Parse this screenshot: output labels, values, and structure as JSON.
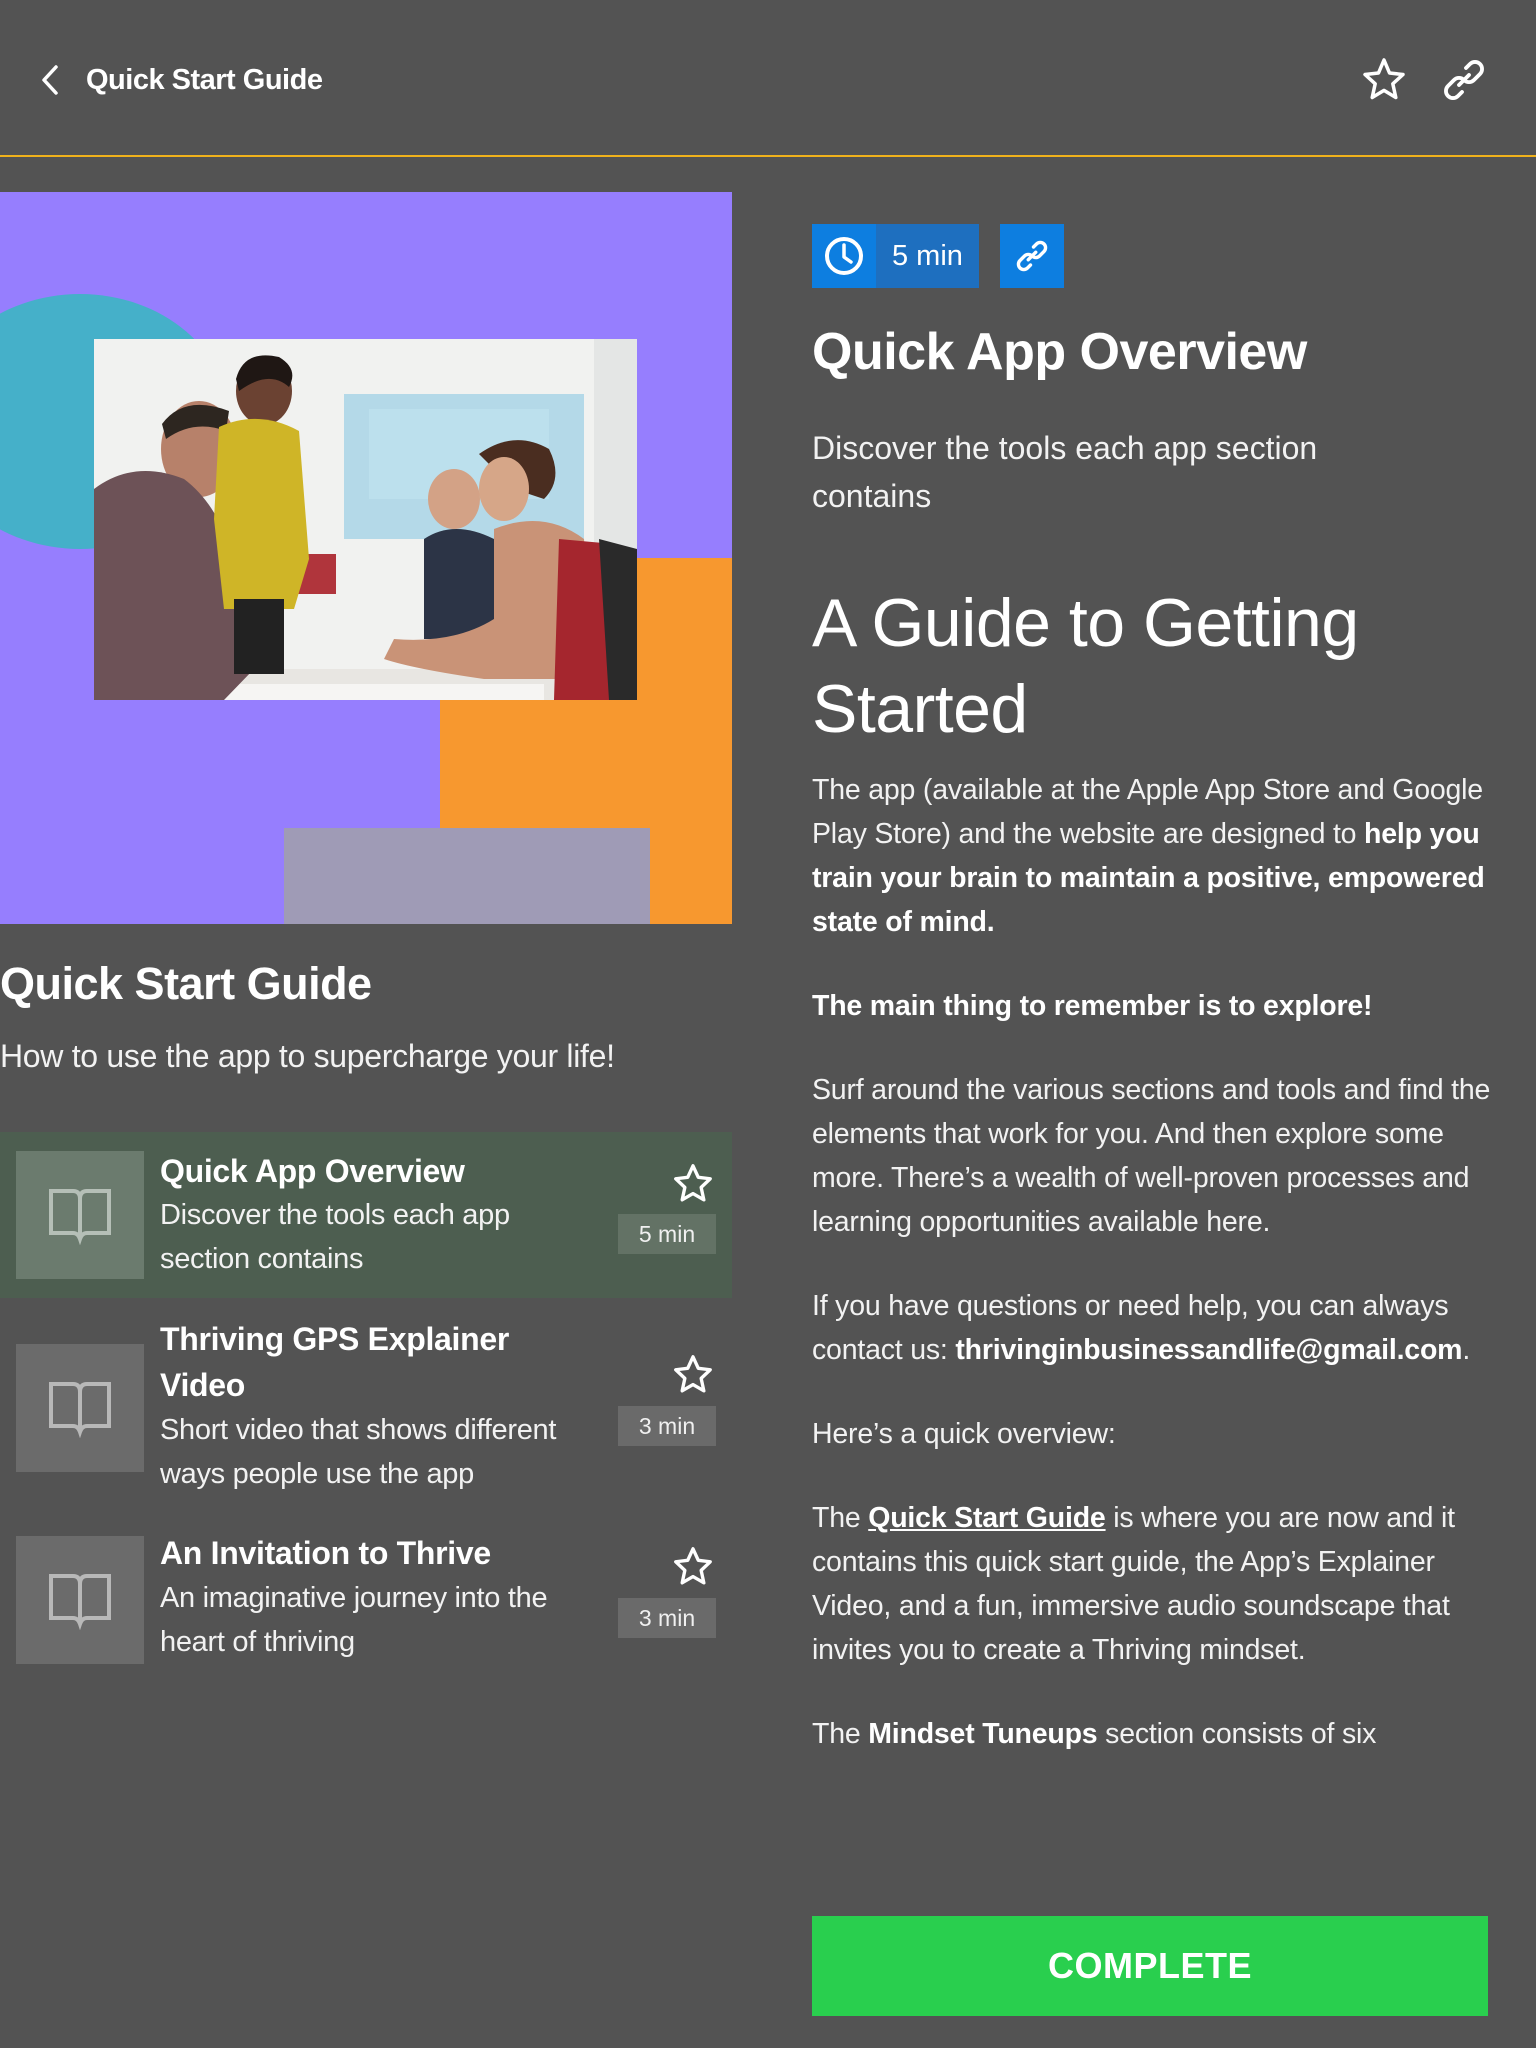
{
  "topbar": {
    "title": "Quick Start Guide",
    "back_icon": "chevron-left-icon",
    "favorite_icon": "star-outline-icon",
    "share_icon": "link-icon"
  },
  "colors": {
    "background": "#535353",
    "accent_line": "#f0b21c",
    "active_item": "#4d5e50",
    "badge_blue": "#0d7ee0",
    "complete_green": "#29cf4e",
    "hero_purple": "#967efe",
    "hero_teal": "#45b0c9",
    "hero_orange": "#f7982f",
    "hero_grey": "#9f9bb6"
  },
  "course": {
    "title": "Quick Start Guide",
    "subtitle": "How to use the app to supercharge your life!",
    "hero_image_alt": "Group of four people smiling around a meeting table"
  },
  "lessons": [
    {
      "title": "Quick App Overview",
      "description": "Discover the tools each app section contains",
      "duration": "5 min",
      "active": true,
      "icon": "book-open-icon"
    },
    {
      "title": "Thriving GPS Explainer Video",
      "description": "Short video that shows different ways people use the app",
      "duration": "3 min",
      "active": false,
      "icon": "book-open-icon"
    },
    {
      "title": "An Invitation to Thrive",
      "description": "An imaginative journey into the heart of thriving",
      "duration": "3 min",
      "active": false,
      "icon": "book-open-icon"
    }
  ],
  "detail": {
    "duration": "5 min",
    "clock_icon": "clock-icon",
    "link_icon": "link-icon",
    "title": "Quick App Overview",
    "subtitle": "Discover the tools each app section contains"
  },
  "article": {
    "heading": "A Guide to Getting Started",
    "p1_a": "The app (available at the Apple App Store and Google Play Store) and the website are designed to ",
    "p1_b": "help you train your brain to maintain a positive, empowered state of mind.",
    "p2": "The main thing to remember is to explore!",
    "p3": "Surf around the various sections and tools and find the elements that work for you. And then explore some more. There’s a wealth of well-proven processes and learning opportunities available here.",
    "p4_a": "If you have questions or need help, you can always contact us: ",
    "p4_email": "thrivinginbusinessandlife@gmail.com",
    "p4_c": ".",
    "p5": "Here’s a quick overview:",
    "p6_a": "The ",
    "p6_link": "Quick Start Guide",
    "p6_b": " is where you are now and it contains this quick start guide, the App’s Explainer Video, and a fun, immersive audio soundscape that invites you to create a Thriving mindset.",
    "p7_a": "The ",
    "p7_b": "Mindset Tuneups",
    "p7_c": " section consists of six"
  },
  "actions": {
    "complete_label": "COMPLETE"
  }
}
